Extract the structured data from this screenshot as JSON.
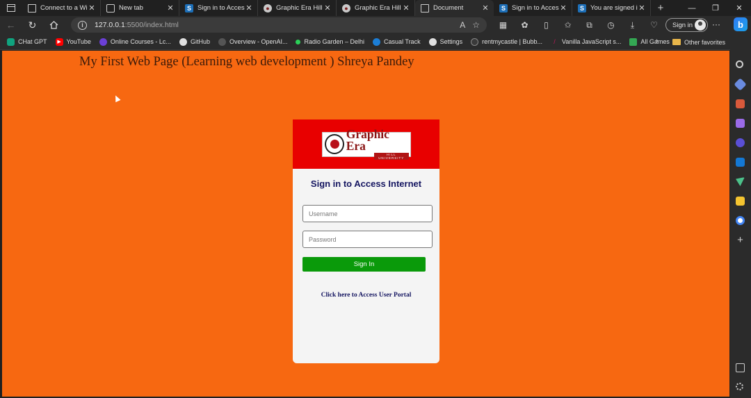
{
  "tabs": [
    {
      "title": "Connect to a Wi-Fi hot",
      "favicon": "wifi-page-icon",
      "active": false
    },
    {
      "title": "New tab",
      "favicon": "new-tab-icon",
      "active": false
    },
    {
      "title": "Sign in to Access",
      "favicon": "s-icon",
      "active": false
    },
    {
      "title": "Graphic Era Hill U",
      "favicon": "graphic-era-icon",
      "active": false
    },
    {
      "title": "Graphic Era Hill U",
      "favicon": "graphic-era-icon",
      "active": false
    },
    {
      "title": "Document",
      "favicon": "document-icon",
      "active": true
    },
    {
      "title": "Sign in to Access",
      "favicon": "s-icon",
      "active": false
    },
    {
      "title": "You are signed in",
      "favicon": "s-icon",
      "active": false
    }
  ],
  "address": {
    "host": "127.0.0.1",
    "path": ":5500/index.html"
  },
  "toolbar": {
    "signin_label": "Sign in",
    "more_label": "···"
  },
  "bookmarks": [
    {
      "label": "CHat GPT",
      "icon": "chatgpt-icon",
      "color": "#10a37f"
    },
    {
      "label": "YouTube",
      "icon": "youtube-icon",
      "color": "#ff0000"
    },
    {
      "label": "Online Courses - Lc...",
      "icon": "courses-icon",
      "color": "#6b3fd6"
    },
    {
      "label": "GitHub",
      "icon": "github-icon",
      "color": "#e0e0e0"
    },
    {
      "label": "Overview - OpenAI...",
      "icon": "openai-icon",
      "color": "#555555"
    },
    {
      "label": "Radio Garden – Delhi",
      "icon": "radio-garden-icon",
      "color": "#2bd158"
    },
    {
      "label": "Casual Track",
      "icon": "casual-track-icon",
      "color": "#1c7ed6"
    },
    {
      "label": "Settings",
      "icon": "github-icon",
      "color": "#e0e0e0"
    },
    {
      "label": "rentmycastle | Bubb...",
      "icon": "bubble-icon",
      "color": "#3a3a3a"
    },
    {
      "label": "Vanilla JavaScript s...",
      "icon": "vanilla-js-icon",
      "color": "#c2185b"
    },
    {
      "label": "All Games",
      "icon": "drive-icon",
      "color": "#34a853"
    }
  ],
  "bookmarks_other": "Other favorites",
  "page": {
    "heading": "My First Web Page (Learning web development ) Shreya Pandey",
    "logo_brand": "Graphic Era",
    "logo_sub": "HILL UNIVERSITY",
    "card_title": "Sign in to Access Internet",
    "username_placeholder": "Username",
    "password_placeholder": "Password",
    "signin_button": "Sign In",
    "portal_link": "Click here to Access User Portal"
  },
  "colors": {
    "page_bg": "#f76811",
    "header_red": "#e80000",
    "signin_green": "#0a9a0a",
    "title_navy": "#141560"
  }
}
